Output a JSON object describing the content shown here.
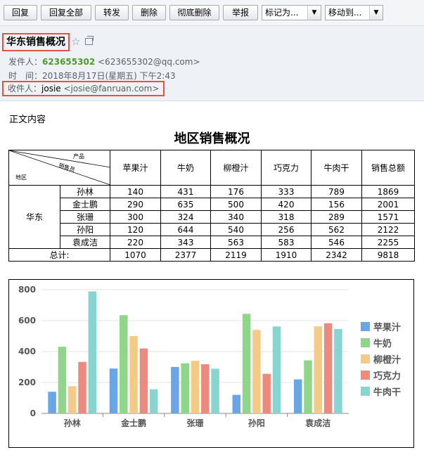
{
  "toolbar": {
    "reply": "回复",
    "reply_all": "回复全部",
    "forward": "转发",
    "delete": "删除",
    "delete_permanently": "彻底删除",
    "report": "举报",
    "mark_as": "标记为...",
    "move_to": "移动到..."
  },
  "header": {
    "subject": "华东销售概况",
    "from_label": "发件人：",
    "from_name": "623655302",
    "from_addr": "<623655302@qq.com>",
    "time_label": "时　间：",
    "time_value": "2018年8月17日(星期五) 下午2:43",
    "to_label": "收件人：",
    "to_name": "josie",
    "to_addr": "<josie@fanruan.com>"
  },
  "body": {
    "label": "正文内容",
    "report_title": "地区销售概况"
  },
  "table": {
    "corner_product": "产品",
    "corner_sales": "销售员",
    "corner_region": "地区",
    "columns": [
      "苹果汁",
      "牛奶",
      "柳橙汁",
      "巧克力",
      "牛肉干",
      "销售总额"
    ],
    "region": "华东",
    "rows": [
      {
        "name": "孙林",
        "values": [
          "140",
          "431",
          "176",
          "333",
          "789",
          "1869"
        ]
      },
      {
        "name": "金士鹏",
        "values": [
          "290",
          "635",
          "500",
          "420",
          "156",
          "2001"
        ]
      },
      {
        "name": "张珊",
        "values": [
          "300",
          "324",
          "340",
          "318",
          "289",
          "1571"
        ]
      },
      {
        "name": "孙阳",
        "values": [
          "120",
          "644",
          "540",
          "256",
          "562",
          "2122"
        ]
      },
      {
        "name": "袁成洁",
        "values": [
          "220",
          "343",
          "563",
          "583",
          "546",
          "2255"
        ]
      }
    ],
    "total_label": "总计:",
    "totals": [
      "1070",
      "2377",
      "2119",
      "1910",
      "2342",
      "9818"
    ]
  },
  "chart_data": {
    "type": "bar",
    "categories": [
      "孙林",
      "金士鹏",
      "张珊",
      "孙阳",
      "袁成洁"
    ],
    "series": [
      {
        "name": "苹果汁",
        "color": "#6aa6e6",
        "values": [
          140,
          290,
          300,
          120,
          220
        ]
      },
      {
        "name": "牛奶",
        "color": "#8fd68a",
        "values": [
          431,
          635,
          324,
          644,
          343
        ]
      },
      {
        "name": "柳橙汁",
        "color": "#f4cb86",
        "values": [
          176,
          500,
          340,
          540,
          563
        ]
      },
      {
        "name": "巧克力",
        "color": "#ec8a80",
        "values": [
          333,
          420,
          318,
          256,
          583
        ]
      },
      {
        "name": "牛肉干",
        "color": "#88d4d0",
        "values": [
          789,
          156,
          289,
          562,
          546
        ]
      }
    ],
    "yticks": [
      "0",
      "200",
      "400",
      "600",
      "800"
    ],
    "ylim": [
      0,
      800
    ],
    "grid": true,
    "legend": "right"
  }
}
